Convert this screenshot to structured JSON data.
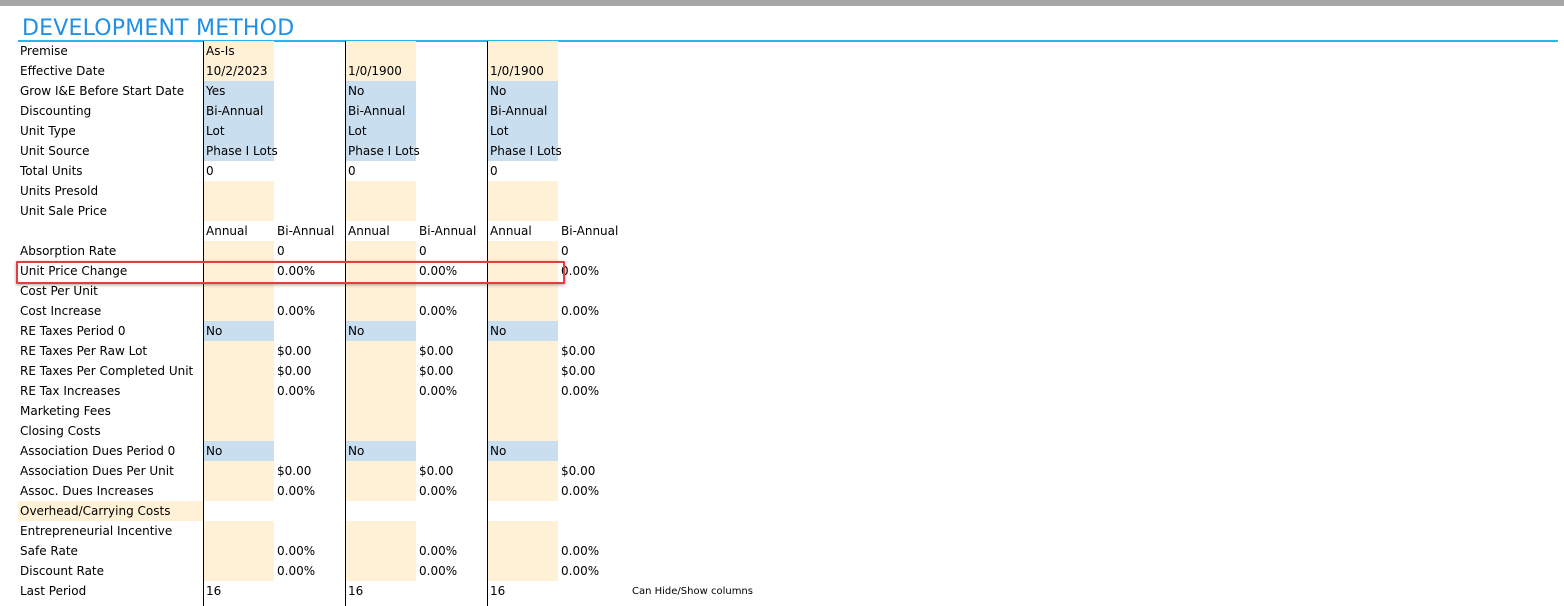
{
  "sheet": {
    "title": "DEVELOPMENT METHOD",
    "note": "Can Hide/Show columns"
  },
  "subheaders": {
    "annual": "Annual",
    "bi_annual": "Bi-Annual"
  },
  "colors": {
    "peach": "#fff1d6",
    "blue": "#c9deef",
    "title": "#1e90e6",
    "highlight": "#e0403c"
  },
  "highlighted_row": "Unit Price Change",
  "rows": [
    {
      "label": "Premise",
      "style": "a-peach",
      "values": [
        [
          "As-Is",
          ""
        ],
        [
          "",
          ""
        ],
        [
          "",
          ""
        ]
      ]
    },
    {
      "label": "Effective Date",
      "style": "a-peach",
      "values": [
        [
          "10/2/2023",
          ""
        ],
        [
          "1/0/1900",
          ""
        ],
        [
          "1/0/1900",
          ""
        ]
      ]
    },
    {
      "label": "Grow I&E Before Start Date",
      "style": "a-blue",
      "values": [
        [
          "Yes",
          ""
        ],
        [
          "No",
          ""
        ],
        [
          "No",
          ""
        ]
      ]
    },
    {
      "label": "Discounting",
      "style": "a-blue",
      "values": [
        [
          "Bi-Annual",
          ""
        ],
        [
          "Bi-Annual",
          ""
        ],
        [
          "Bi-Annual",
          ""
        ]
      ]
    },
    {
      "label": "Unit Type",
      "style": "a-blue",
      "values": [
        [
          "Lot",
          ""
        ],
        [
          "Lot",
          ""
        ],
        [
          "Lot",
          ""
        ]
      ]
    },
    {
      "label": "Unit Source",
      "style": "a-blue",
      "values": [
        [
          "Phase I Lots",
          ""
        ],
        [
          "Phase I Lots",
          ""
        ],
        [
          "Phase I Lots",
          ""
        ]
      ]
    },
    {
      "label": "Total Units",
      "style": "plain",
      "values": [
        [
          "0",
          ""
        ],
        [
          "0",
          ""
        ],
        [
          "0",
          ""
        ]
      ]
    },
    {
      "label": "Units Presold",
      "style": "a-peach",
      "values": [
        [
          "",
          ""
        ],
        [
          "",
          ""
        ],
        [
          "",
          ""
        ]
      ]
    },
    {
      "label": "Unit Sale Price",
      "style": "a-peach",
      "values": [
        [
          "",
          ""
        ],
        [
          "",
          ""
        ],
        [
          "",
          ""
        ]
      ]
    },
    {
      "label": "",
      "style": "subheader",
      "values": [
        [
          "",
          ""
        ],
        [
          "",
          ""
        ],
        [
          "",
          ""
        ]
      ]
    },
    {
      "label": "Absorption Rate",
      "style": "a-peach",
      "values": [
        [
          "",
          "0"
        ],
        [
          "",
          "0"
        ],
        [
          "",
          "0"
        ]
      ]
    },
    {
      "label": "Unit Price Change",
      "style": "a-peach",
      "values": [
        [
          "",
          "0.00%"
        ],
        [
          "",
          "0.00%"
        ],
        [
          "",
          "0.00%"
        ]
      ]
    },
    {
      "label": "Cost Per Unit",
      "style": "a-peach",
      "values": [
        [
          "",
          ""
        ],
        [
          "",
          ""
        ],
        [
          "",
          ""
        ]
      ]
    },
    {
      "label": "Cost Increase",
      "style": "a-peach",
      "values": [
        [
          "",
          "0.00%"
        ],
        [
          "",
          "0.00%"
        ],
        [
          "",
          "0.00%"
        ]
      ]
    },
    {
      "label": "RE Taxes Period 0",
      "style": "a-blue",
      "values": [
        [
          "No",
          ""
        ],
        [
          "No",
          ""
        ],
        [
          "No",
          ""
        ]
      ]
    },
    {
      "label": "RE Taxes Per Raw Lot",
      "style": "a-peach",
      "values": [
        [
          "",
          "$0.00"
        ],
        [
          "",
          "$0.00"
        ],
        [
          "",
          "$0.00"
        ]
      ]
    },
    {
      "label": "RE Taxes Per Completed Unit",
      "style": "a-peach",
      "values": [
        [
          "",
          "$0.00"
        ],
        [
          "",
          "$0.00"
        ],
        [
          "",
          "$0.00"
        ]
      ]
    },
    {
      "label": "RE Tax Increases",
      "style": "a-peach",
      "values": [
        [
          "",
          "0.00%"
        ],
        [
          "",
          "0.00%"
        ],
        [
          "",
          "0.00%"
        ]
      ]
    },
    {
      "label": "Marketing Fees",
      "style": "a-peach",
      "values": [
        [
          "",
          ""
        ],
        [
          "",
          ""
        ],
        [
          "",
          ""
        ]
      ]
    },
    {
      "label": "Closing Costs",
      "style": "a-peach",
      "values": [
        [
          "",
          ""
        ],
        [
          "",
          ""
        ],
        [
          "",
          ""
        ]
      ]
    },
    {
      "label": "Association Dues Period 0",
      "style": "a-blue",
      "values": [
        [
          "No",
          ""
        ],
        [
          "No",
          ""
        ],
        [
          "No",
          ""
        ]
      ]
    },
    {
      "label": "Association Dues Per Unit",
      "style": "a-peach",
      "values": [
        [
          "",
          "$0.00"
        ],
        [
          "",
          "$0.00"
        ],
        [
          "",
          "$0.00"
        ]
      ]
    },
    {
      "label": "Assoc. Dues Increases",
      "style": "a-peach",
      "values": [
        [
          "",
          "0.00%"
        ],
        [
          "",
          "0.00%"
        ],
        [
          "",
          "0.00%"
        ]
      ]
    },
    {
      "label": "Overhead/Carrying Costs",
      "style": "l-peach",
      "values": [
        [
          "",
          ""
        ],
        [
          "",
          ""
        ],
        [
          "",
          ""
        ]
      ]
    },
    {
      "label": "Entrepreneurial Incentive",
      "style": "a-peach",
      "values": [
        [
          "",
          ""
        ],
        [
          "",
          ""
        ],
        [
          "",
          ""
        ]
      ]
    },
    {
      "label": "Safe Rate",
      "style": "a-peach",
      "values": [
        [
          "",
          "0.00%"
        ],
        [
          "",
          "0.00%"
        ],
        [
          "",
          "0.00%"
        ]
      ]
    },
    {
      "label": "Discount Rate",
      "style": "a-peach",
      "values": [
        [
          "",
          "0.00%"
        ],
        [
          "",
          "0.00%"
        ],
        [
          "",
          "0.00%"
        ]
      ]
    },
    {
      "label": "Last Period",
      "style": "plain",
      "values": [
        [
          "16",
          ""
        ],
        [
          "16",
          ""
        ],
        [
          "16",
          ""
        ]
      ]
    }
  ]
}
